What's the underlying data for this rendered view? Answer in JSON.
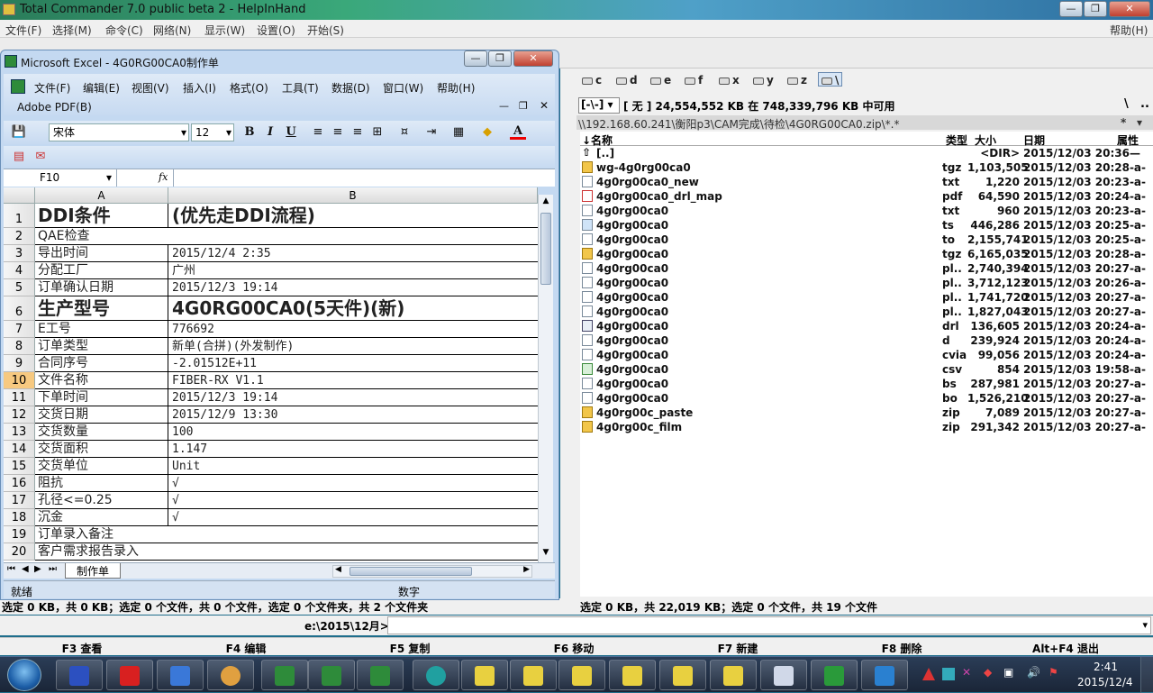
{
  "tc": {
    "title": "Total Commander 7.0 public beta 2 - HelpInHand",
    "menu": [
      "文件(F)",
      "选择(M)",
      "命令(C)",
      "网络(N)",
      "显示(W)",
      "设置(O)",
      "开始(S)"
    ],
    "help": "帮助(H)",
    "drives": [
      "c",
      "d",
      "e",
      "f",
      "x",
      "y",
      "z",
      "\\"
    ],
    "drive_select": "[-\\-]",
    "drive_info": "[ 无 ]  24,554,552 KB 在 748,339,796 KB 中可用",
    "root_btn": "\\",
    "parent_btn": "..",
    "path": "\\\\192.168.60.241\\衡阳p3\\CAM完成\\待检\\4G0RG00CA0.zip\\*.*",
    "path_star": "*",
    "columns": {
      "name": "↓名称",
      "type": "类型",
      "size": "大小",
      "date": "日期",
      "attr": "属性"
    },
    "files": [
      {
        "name": "[..]",
        "type": "",
        "size": "<DIR>",
        "date": "2015/12/03 20:36—",
        "icon": "up"
      },
      {
        "name": "wg-4g0rg00ca0",
        "type": "tgz",
        "size": "1,103,505",
        "date": "2015/12/03 20:28-a-",
        "icon": "zip"
      },
      {
        "name": "4g0rg00ca0_new",
        "type": "txt",
        "size": "1,220",
        "date": "2015/12/03 20:23-a-",
        "icon": "txt"
      },
      {
        "name": "4g0rg00ca0_drl_map",
        "type": "pdf",
        "size": "64,590",
        "date": "2015/12/03 20:24-a-",
        "icon": "pdf"
      },
      {
        "name": "4g0rg00ca0",
        "type": "txt",
        "size": "960",
        "date": "2015/12/03 20:23-a-",
        "icon": "txt"
      },
      {
        "name": "4g0rg00ca0",
        "type": "ts",
        "size": "446,286",
        "date": "2015/12/03 20:25-a-",
        "icon": "ts"
      },
      {
        "name": "4g0rg00ca0",
        "type": "to",
        "size": "2,155,741",
        "date": "2015/12/03 20:25-a-",
        "icon": "txt"
      },
      {
        "name": "4g0rg00ca0",
        "type": "tgz",
        "size": "6,165,035",
        "date": "2015/12/03 20:28-a-",
        "icon": "zip"
      },
      {
        "name": "4g0rg00ca0",
        "type": "pl..",
        "size": "2,740,394",
        "date": "2015/12/03 20:27-a-",
        "icon": "txt"
      },
      {
        "name": "4g0rg00ca0",
        "type": "pl..",
        "size": "3,712,123",
        "date": "2015/12/03 20:26-a-",
        "icon": "txt"
      },
      {
        "name": "4g0rg00ca0",
        "type": "pl..",
        "size": "1,741,720",
        "date": "2015/12/03 20:27-a-",
        "icon": "txt"
      },
      {
        "name": "4g0rg00ca0",
        "type": "pl..",
        "size": "1,827,043",
        "date": "2015/12/03 20:27-a-",
        "icon": "txt"
      },
      {
        "name": "4g0rg00ca0",
        "type": "drl",
        "size": "136,605",
        "date": "2015/12/03 20:24-a-",
        "icon": "drl"
      },
      {
        "name": "4g0rg00ca0",
        "type": "d",
        "size": "239,924",
        "date": "2015/12/03 20:24-a-",
        "icon": "txt"
      },
      {
        "name": "4g0rg00ca0",
        "type": "cvia",
        "size": "99,056",
        "date": "2015/12/03 20:24-a-",
        "icon": "txt"
      },
      {
        "name": "4g0rg00ca0",
        "type": "csv",
        "size": "854",
        "date": "2015/12/03 19:58-a-",
        "icon": "csv"
      },
      {
        "name": "4g0rg00ca0",
        "type": "bs",
        "size": "287,981",
        "date": "2015/12/03 20:27-a-",
        "icon": "txt"
      },
      {
        "name": "4g0rg00ca0",
        "type": "bo",
        "size": "1,526,210",
        "date": "2015/12/03 20:27-a-",
        "icon": "txt"
      },
      {
        "name": "4g0rg00c_paste",
        "type": "zip",
        "size": "7,089",
        "date": "2015/12/03 20:27-a-",
        "icon": "zip"
      },
      {
        "name": "4g0rg00c_film",
        "type": "zip",
        "size": "291,342",
        "date": "2015/12/03 20:27-a-",
        "icon": "zip"
      }
    ],
    "left_status": "选定 0 KB，共 0 KB；选定 0 个文件，共 0 个文件，选定 0 个文件夹，共 2 个文件夹",
    "right_status": "选定 0 KB，共 22,019 KB；选定 0 个文件，共 19 个文件",
    "cmd_path": "e:\\2015\\12月>",
    "fkeys": [
      "F3 查看",
      "F4 编辑",
      "F5 复制",
      "F6 移动",
      "F7 新建",
      "F8 删除",
      "Alt+F4 退出"
    ]
  },
  "excel": {
    "title": "Microsoft Excel - 4G0RG00CA0制作单",
    "menu": [
      "文件(F)",
      "编辑(E)",
      "视图(V)",
      "插入(I)",
      "格式(O)",
      "工具(T)",
      "数据(D)",
      "窗口(W)",
      "帮助(H)"
    ],
    "adobe": "Adobe PDF(B)",
    "font_name": "宋体",
    "font_size": "12",
    "bold": "B",
    "italic": "I",
    "underline": "U",
    "font_color_label": "A",
    "name_box": "F10",
    "fx": "fx",
    "col_a": "A",
    "col_b": "B",
    "rows": [
      {
        "n": "1",
        "a": "DDI条件",
        "b": "(优先走DDI流程)",
        "big": true
      },
      {
        "n": "2",
        "a": "QAE检查",
        "b": "",
        "span": true
      },
      {
        "n": "3",
        "a": "导出时间",
        "b": "2015/12/4 2:35"
      },
      {
        "n": "4",
        "a": "分配工厂",
        "b": "广州"
      },
      {
        "n": "5",
        "a": "订单确认日期",
        "b": "2015/12/3 19:14"
      },
      {
        "n": "6",
        "a": "生产型号",
        "b": "4G0RG00CA0(5天件)(新)",
        "big": true
      },
      {
        "n": "7",
        "a": "E工号",
        "b": "776692"
      },
      {
        "n": "8",
        "a": "订单类型",
        "b": "新单(合拼)(外发制作)"
      },
      {
        "n": "9",
        "a": "合同序号",
        "b": "-2.01512E+11"
      },
      {
        "n": "10",
        "a": "文件名称",
        "b": "FIBER-RX V1.1"
      },
      {
        "n": "11",
        "a": "下单时间",
        "b": "2015/12/3 19:14"
      },
      {
        "n": "12",
        "a": "交货日期",
        "b": "2015/12/9 13:30"
      },
      {
        "n": "13",
        "a": "交货数量",
        "b": "100"
      },
      {
        "n": "14",
        "a": "交货面积",
        "b": "1.147"
      },
      {
        "n": "15",
        "a": "交货单位",
        "b": "Unit"
      },
      {
        "n": "16",
        "a": "阻抗",
        "b": "√"
      },
      {
        "n": "17",
        "a": "孔径<=0.25",
        "b": "√"
      },
      {
        "n": "18",
        "a": "沉金",
        "b": "√"
      },
      {
        "n": "19",
        "a": "订单录入备注",
        "b": "",
        "span": true
      },
      {
        "n": "20",
        "a": "客户需求报告录入",
        "b": "",
        "span": true
      }
    ],
    "sheet_tab": "制作单",
    "status_ready": "就绪",
    "status_num": "数字"
  },
  "taskbar": {
    "time": "2:41",
    "date": "2015/12/4"
  }
}
